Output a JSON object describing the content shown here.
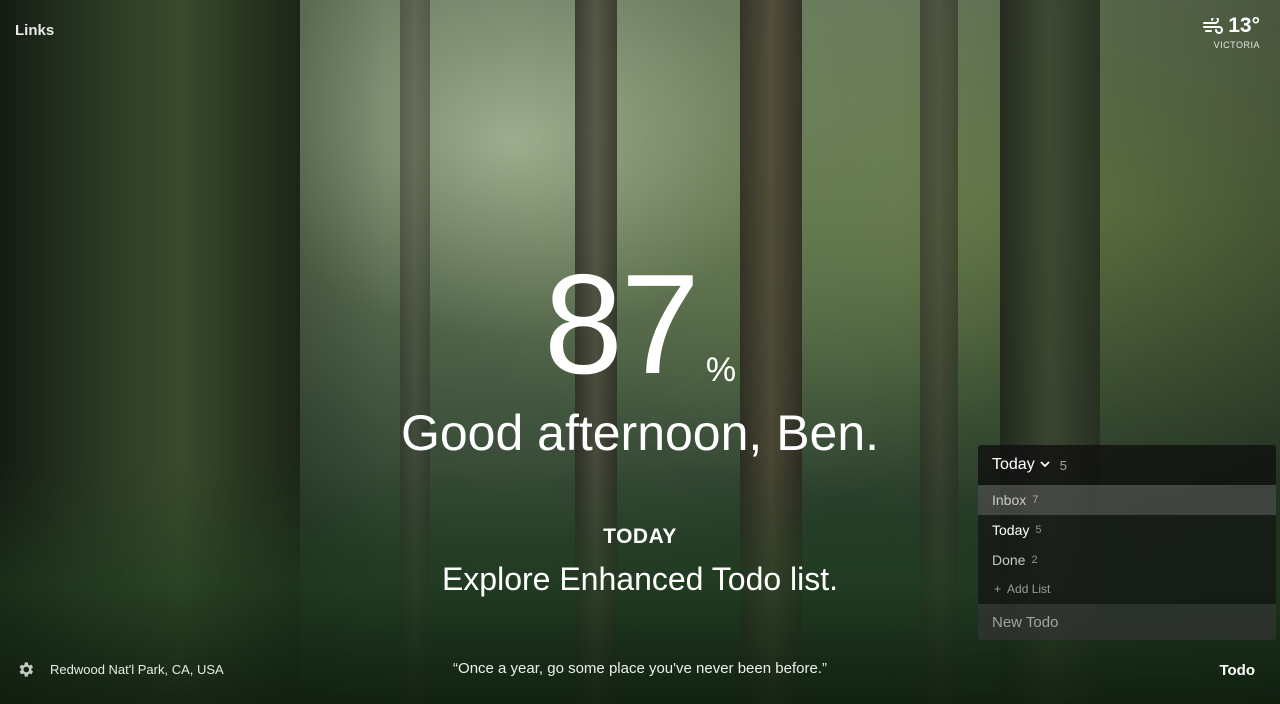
{
  "top_left": {
    "links_label": "Links"
  },
  "weather": {
    "temperature": "13°",
    "location": "VICTORIA",
    "icon": "wind-icon"
  },
  "clock": {
    "value": "87",
    "unit": "%"
  },
  "greeting": "Good afternoon, Ben.",
  "focus": {
    "label": "TODAY",
    "text": "Explore Enhanced Todo list."
  },
  "footer": {
    "settings_icon": "gear-icon",
    "location": "Redwood Nat'l Park, CA, USA",
    "quote": "“Once a year, go some place you've never been before.”",
    "todo_label": "Todo"
  },
  "todo": {
    "header": {
      "label": "Today",
      "count": "5"
    },
    "lists": [
      {
        "label": "Inbox",
        "count": "7"
      },
      {
        "label": "Today",
        "count": "5"
      },
      {
        "label": "Done",
        "count": "2"
      }
    ],
    "add_list_label": "Add List",
    "new_todo_placeholder": "New Todo"
  }
}
